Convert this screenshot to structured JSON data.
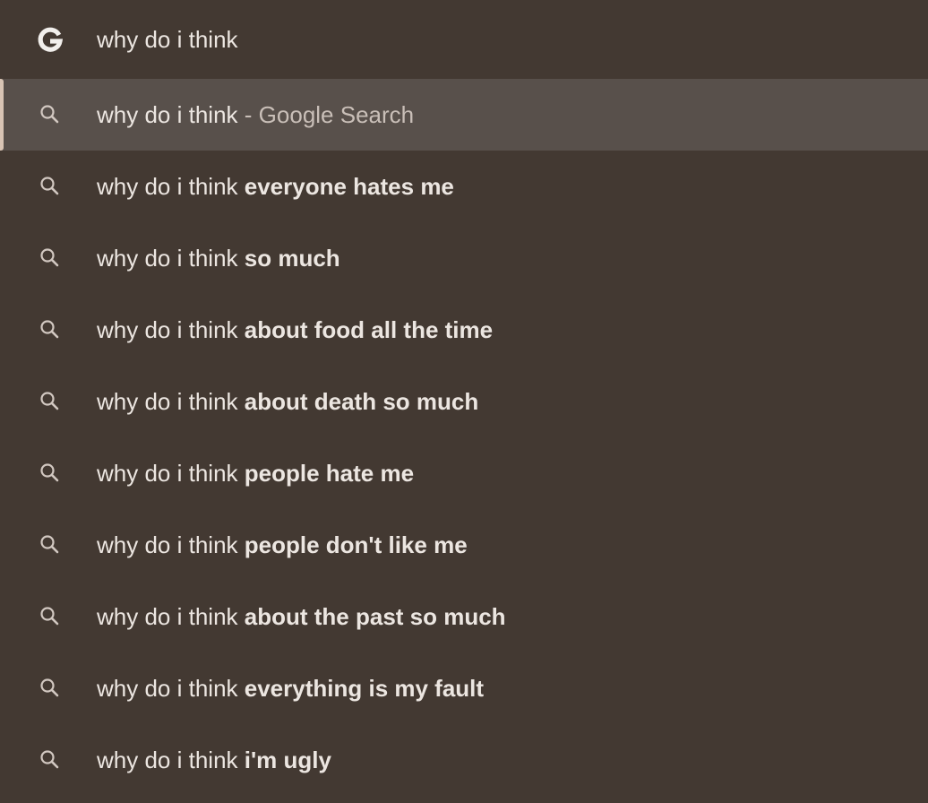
{
  "input": {
    "value": "why do i think",
    "icon": "google-g-icon"
  },
  "colors": {
    "background": "#433932",
    "selected_row": "#58504b",
    "text": "#ece6e1",
    "secondary_text": "#c9bfb8"
  },
  "suggestions": [
    {
      "typed": "why do i think",
      "completion": "",
      "separator": "-",
      "secondary": "Google Search",
      "icon": "search-icon",
      "selected": true
    },
    {
      "typed": "why do i think",
      "completion": "everyone hates me",
      "icon": "search-icon"
    },
    {
      "typed": "why do i think",
      "completion": "so much",
      "icon": "search-icon"
    },
    {
      "typed": "why do i think",
      "completion": "about food all the time",
      "icon": "search-icon"
    },
    {
      "typed": "why do i think",
      "completion": "about death so much",
      "icon": "search-icon"
    },
    {
      "typed": "why do i think",
      "completion": "people hate me",
      "icon": "search-icon"
    },
    {
      "typed": "why do i think",
      "completion": "people don't like me",
      "icon": "search-icon"
    },
    {
      "typed": "why do i think",
      "completion": "about the past so much",
      "icon": "search-icon"
    },
    {
      "typed": "why do i think",
      "completion": "everything is my fault",
      "icon": "search-icon"
    },
    {
      "typed": "why do i think",
      "completion": "i'm ugly",
      "icon": "search-icon"
    }
  ]
}
